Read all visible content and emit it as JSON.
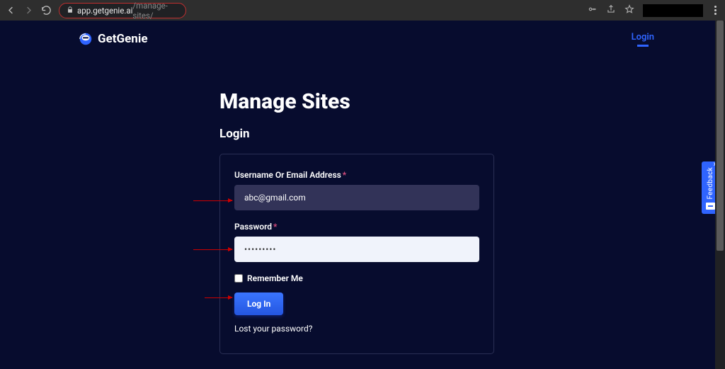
{
  "browser": {
    "url_domain": "app.getgenie.ai",
    "url_path": "/manage-sites/"
  },
  "header": {
    "brand": "GetGenie",
    "login_link": "Login"
  },
  "page": {
    "title": "Manage Sites",
    "subtitle": "Login"
  },
  "form": {
    "username_label": "Username Or Email Address",
    "username_value": "abc@gmail.com",
    "password_label": "Password",
    "password_value": "•••••••••",
    "remember_label": "Remember Me",
    "submit_label": "Log In",
    "lost_password": "Lost your password?"
  },
  "feedback": {
    "label": "Feedback"
  }
}
